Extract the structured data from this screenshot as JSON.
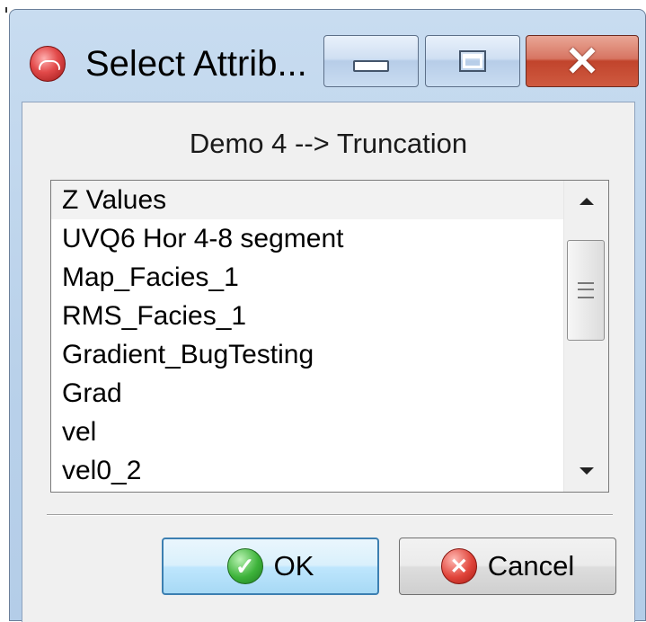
{
  "window": {
    "title": "Select Attrib...",
    "controls": {
      "minimize_icon": "minimize-icon",
      "maximize_icon": "maximize-icon",
      "close_icon": "close-icon",
      "close_glyph": "✕"
    }
  },
  "dialog": {
    "subtitle": "Demo 4 --> Truncation"
  },
  "attribute_list": {
    "items": [
      "Z Values",
      "UVQ6 Hor 4-8 segment",
      "Map_Facies_1",
      "RMS_Facies_1",
      "Gradient_BugTesting",
      "Grad",
      "vel",
      "vel0_2"
    ],
    "scrollbar": {
      "up_icon": "arrow-up-icon",
      "down_icon": "arrow-down-icon",
      "grip_icon": "grip-icon"
    }
  },
  "buttons": {
    "ok_label": "OK",
    "ok_icon": "check-circle-icon",
    "ok_glyph": "✓",
    "cancel_label": "Cancel",
    "cancel_icon": "x-circle-icon",
    "cancel_glyph": "✕"
  },
  "colors": {
    "title_bar": "#b9d1ea",
    "close_button": "#c1442c",
    "ok_button_border": "#3c7fb1",
    "client_background": "#f0f0f0"
  }
}
